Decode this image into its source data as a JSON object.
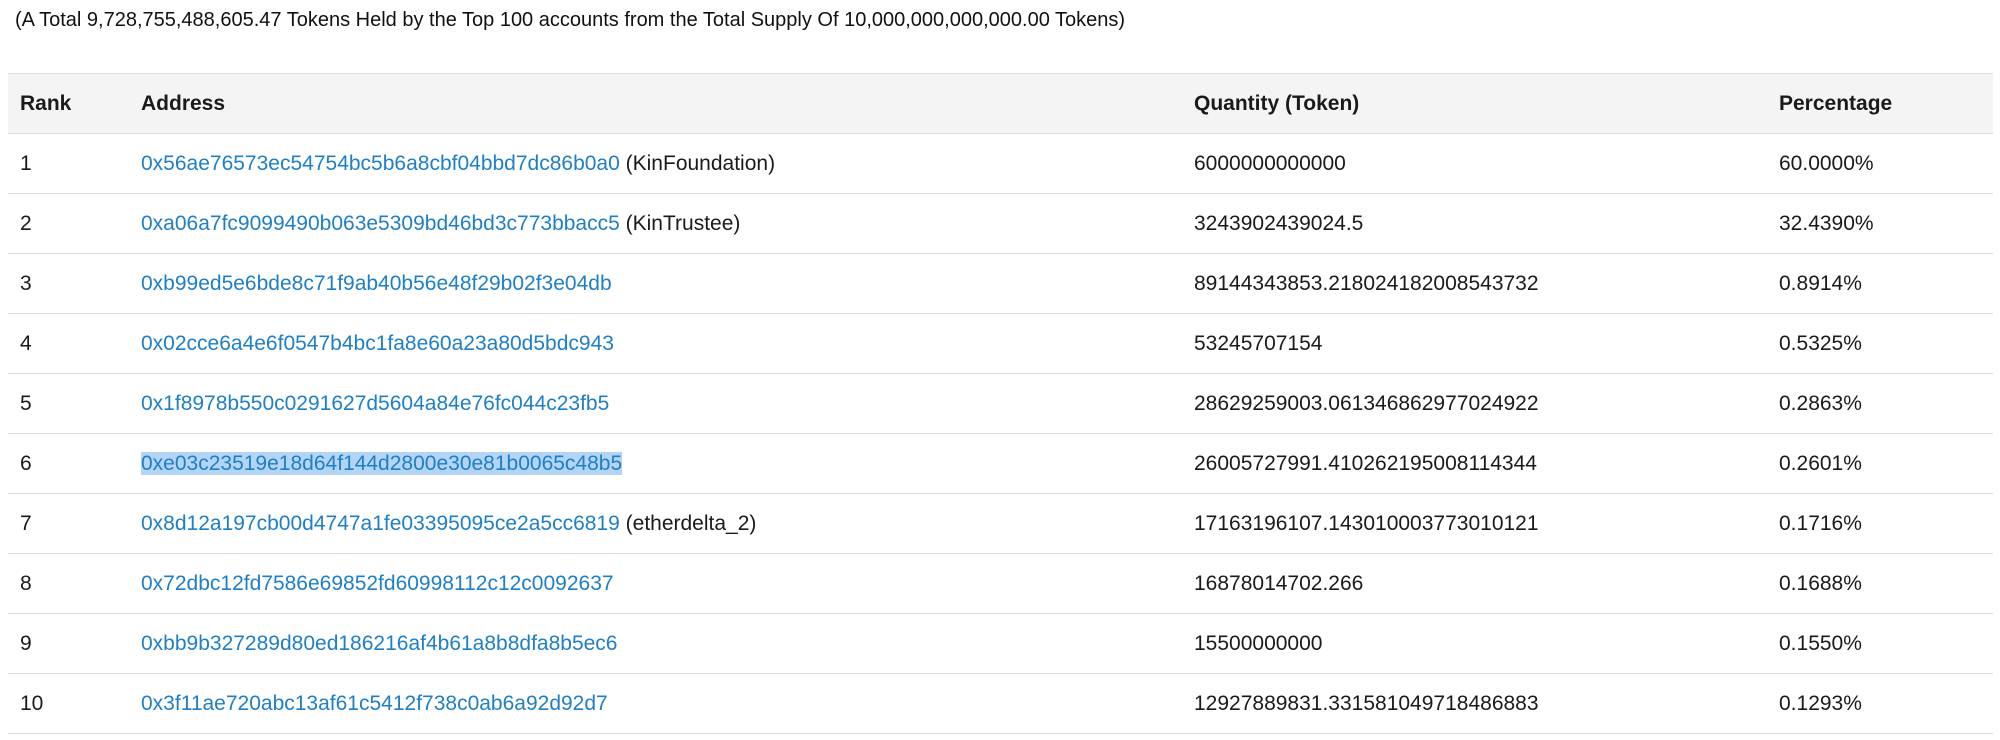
{
  "summary": "(A Total 9,728,755,488,605.47 Tokens Held by the Top 100 accounts from the Total Supply Of 10,000,000,000,000.00 Tokens)",
  "table": {
    "headers": {
      "rank": "Rank",
      "address": "Address",
      "quantity": "Quantity (Token)",
      "percentage": "Percentage"
    },
    "rows": [
      {
        "rank": "1",
        "address": "0x56ae76573ec54754bc5b6a8cbf04bbd7dc86b0a0",
        "label": "(KinFoundation)",
        "quantity": "6000000000000",
        "percentage": "60.0000%"
      },
      {
        "rank": "2",
        "address": "0xa06a7fc9099490b063e5309bd46bd3c773bbacc5",
        "label": "(KinTrustee)",
        "quantity": "3243902439024.5",
        "percentage": "32.4390%"
      },
      {
        "rank": "3",
        "address": "0xb99ed5e6bde8c71f9ab40b56e48f29b02f3e04db",
        "label": "",
        "quantity": "89144343853.218024182008543732",
        "percentage": "0.8914%"
      },
      {
        "rank": "4",
        "address": "0x02cce6a4e6f0547b4bc1fa8e60a23a80d5bdc943",
        "label": "",
        "quantity": "53245707154",
        "percentage": "0.5325%"
      },
      {
        "rank": "5",
        "address": "0x1f8978b550c0291627d5604a84e76fc044c23fb5",
        "label": "",
        "quantity": "28629259003.061346862977024922",
        "percentage": "0.2863%"
      },
      {
        "rank": "6",
        "address": "0xe03c23519e18d64f144d2800e30e81b0065c48b5",
        "label": "",
        "quantity": "26005727991.410262195008114344",
        "percentage": "0.2601%"
      },
      {
        "rank": "7",
        "address": "0x8d12a197cb00d4747a1fe03395095ce2a5cc6819",
        "label": "(etherdelta_2)",
        "quantity": "17163196107.143010003773010121",
        "percentage": "0.1716%"
      },
      {
        "rank": "8",
        "address": "0x72dbc12fd7586e69852fd60998112c12c0092637",
        "label": "",
        "quantity": "16878014702.266",
        "percentage": "0.1688%"
      },
      {
        "rank": "9",
        "address": "0xbb9b327289d80ed186216af4b61a8b8dfa8b5ec6",
        "label": "",
        "quantity": "15500000000",
        "percentage": "0.1550%"
      },
      {
        "rank": "10",
        "address": "0x3f11ae720abc13af61c5412f738c0ab6a92d92d7",
        "label": "",
        "quantity": "12927889831.331581049718486883",
        "percentage": "0.1293%"
      }
    ]
  },
  "selection": {
    "row_rank": "6"
  },
  "colors": {
    "link": "#1e7fc8",
    "header_background": "#f4f4f4",
    "border": "#dddddd",
    "selection_highlight": "#b3d4f5"
  }
}
